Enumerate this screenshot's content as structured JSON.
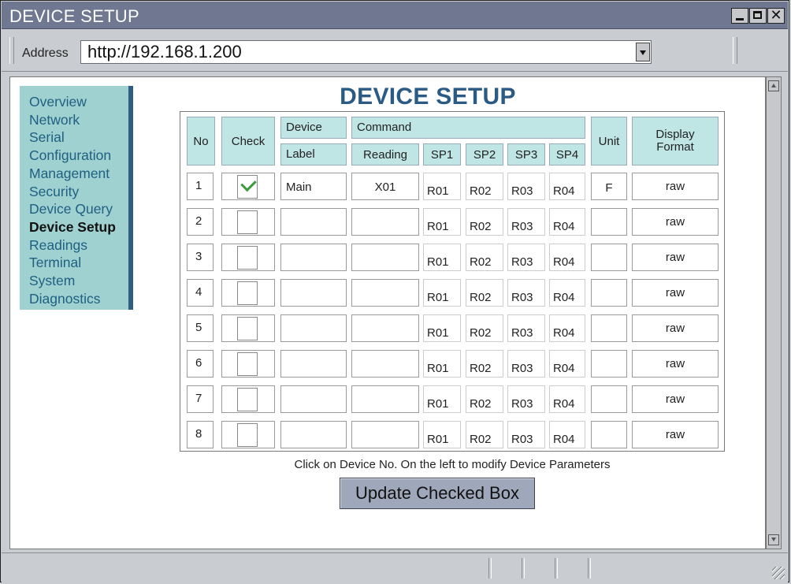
{
  "window": {
    "title": "DEVICE SETUP"
  },
  "address": {
    "label": "Address",
    "url": "http://192.168.1.200"
  },
  "nav": {
    "items": [
      {
        "label": "Overview",
        "active": false
      },
      {
        "label": "Network",
        "active": false
      },
      {
        "label": "Serial",
        "active": false
      },
      {
        "label": "Configuration",
        "active": false
      },
      {
        "label": "Management",
        "active": false
      },
      {
        "label": "Security",
        "active": false
      },
      {
        "label": "Device Query",
        "active": false
      },
      {
        "label": "Device Setup",
        "active": true
      },
      {
        "label": "Readings",
        "active": false
      },
      {
        "label": "Terminal",
        "active": false
      },
      {
        "label": "System",
        "active": false
      },
      {
        "label": "Diagnostics",
        "active": false
      }
    ]
  },
  "page": {
    "title": "DEVICE SETUP",
    "footnote": "Click on Device No. On the left to modify Device Parameters",
    "button": "Update Checked Box"
  },
  "table": {
    "headers": {
      "no": "No",
      "check": "Check",
      "device": "Device",
      "label": "Label",
      "command": "Command",
      "reading": "Reading",
      "sp1": "SP1",
      "sp2": "SP2",
      "sp3": "SP3",
      "sp4": "SP4",
      "unit": "Unit",
      "display_format_line1": "Display",
      "display_format_line2": "Format"
    },
    "rows": [
      {
        "no": "1",
        "checked": true,
        "label": "Main",
        "reading": "X01",
        "sp1": "R01",
        "sp2": "R02",
        "sp3": "R03",
        "sp4": "R04",
        "unit": "F",
        "format": "raw"
      },
      {
        "no": "2",
        "checked": false,
        "label": "",
        "reading": "",
        "sp1": "R01",
        "sp2": "R02",
        "sp3": "R03",
        "sp4": "R04",
        "unit": "",
        "format": "raw"
      },
      {
        "no": "3",
        "checked": false,
        "label": "",
        "reading": "",
        "sp1": "R01",
        "sp2": "R02",
        "sp3": "R03",
        "sp4": "R04",
        "unit": "",
        "format": "raw"
      },
      {
        "no": "4",
        "checked": false,
        "label": "",
        "reading": "",
        "sp1": "R01",
        "sp2": "R02",
        "sp3": "R03",
        "sp4": "R04",
        "unit": "",
        "format": "raw"
      },
      {
        "no": "5",
        "checked": false,
        "label": "",
        "reading": "",
        "sp1": "R01",
        "sp2": "R02",
        "sp3": "R03",
        "sp4": "R04",
        "unit": "",
        "format": "raw"
      },
      {
        "no": "6",
        "checked": false,
        "label": "",
        "reading": "",
        "sp1": "R01",
        "sp2": "R02",
        "sp3": "R03",
        "sp4": "R04",
        "unit": "",
        "format": "raw"
      },
      {
        "no": "7",
        "checked": false,
        "label": "",
        "reading": "",
        "sp1": "R01",
        "sp2": "R02",
        "sp3": "R03",
        "sp4": "R04",
        "unit": "",
        "format": "raw"
      },
      {
        "no": "8",
        "checked": false,
        "label": "",
        "reading": "",
        "sp1": "R01",
        "sp2": "R02",
        "sp3": "R03",
        "sp4": "R04",
        "unit": "",
        "format": "raw"
      }
    ]
  },
  "colors": {
    "title_bar": "#6f7890",
    "nav_bg": "#9fd1d1",
    "nav_text": "#1f5f80",
    "header_bg": "#bfe5e5",
    "page_title": "#2a5b84",
    "check_green": "#3a9a3e",
    "button_bg": "#9fa7ba"
  },
  "icons": {
    "minimize": "minimize-icon",
    "maximize": "maximize-icon",
    "close": "close-icon",
    "dropdown": "chevron-down-icon",
    "check": "checkmark-icon"
  }
}
